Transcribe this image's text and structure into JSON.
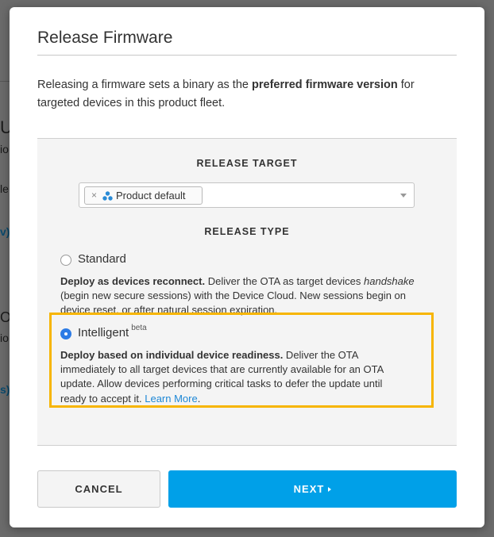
{
  "background": {
    "fragments": [
      "U",
      "io",
      "le",
      "v).",
      "O",
      "io",
      "s)."
    ]
  },
  "modal": {
    "title": "Release Firmware",
    "intro_prefix": "Releasing a firmware sets a binary as the ",
    "intro_bold": "preferred firmware version",
    "intro_suffix": " for targeted devices in this product fleet."
  },
  "release_target": {
    "label": "RELEASE TARGET",
    "tag_remove": "×",
    "tag_icon": "product-icon",
    "tag_label": "Product default"
  },
  "release_type": {
    "label": "RELEASE TYPE",
    "options": [
      {
        "label": "Standard",
        "selected": false,
        "desc_bold": "Deploy as devices reconnect.",
        "desc_1": " Deliver the OTA as target devices ",
        "desc_italic": "handshake",
        "desc_2": " (begin new secure sessions) with the Device Cloud. New sessions begin on device reset, or after natural session expiration."
      },
      {
        "label": "Intelligent",
        "badge": "beta",
        "selected": true,
        "desc_bold": "Deploy based on individual device readiness.",
        "desc_1": " Deliver the OTA immediately to all target devices that are currently available for an OTA update. Allow devices performing critical tasks to defer the update until ready to accept it. ",
        "link": "Learn More",
        "desc_end": "."
      }
    ]
  },
  "buttons": {
    "cancel": "CANCEL",
    "next": "NEXT"
  },
  "colors": {
    "primary": "#00a0e8",
    "highlight": "#f7b500",
    "radio_selected": "#2c7be5",
    "link": "#1f88d6"
  }
}
